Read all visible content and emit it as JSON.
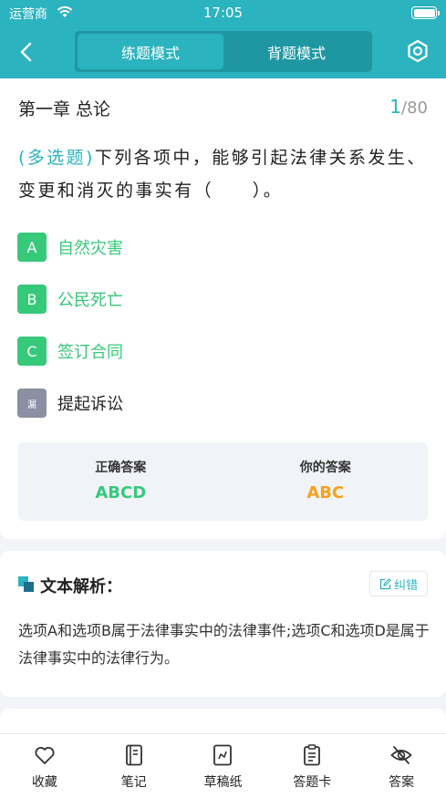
{
  "status_bar": {
    "carrier": "运营商",
    "time": "17:05"
  },
  "header": {
    "modes": [
      {
        "label": "练题模式",
        "active": true
      },
      {
        "label": "背题模式",
        "active": false
      }
    ]
  },
  "question": {
    "chapter": "第一章 总论",
    "progress_current": "1",
    "progress_total": "/80",
    "type_label": "(多选题)",
    "text": "下列各项中，能够引起法律关系发生、变更和消灭的事实有（　　）。",
    "options": [
      {
        "letter": "A",
        "text": "自然灾害",
        "state": "correct"
      },
      {
        "letter": "B",
        "text": "公民死亡",
        "state": "correct"
      },
      {
        "letter": "C",
        "text": "签订合同",
        "state": "correct"
      },
      {
        "letter": "漏",
        "text": "提起诉讼",
        "state": "missed"
      }
    ]
  },
  "answers": {
    "correct_label": "正确答案",
    "correct_value": "ABCD",
    "yours_label": "你的答案",
    "yours_value": "ABC"
  },
  "analysis": {
    "title": "文本解析：",
    "report_label": "纠错",
    "text": "选项A和选项B属于法律事实中的法律事件;选项C和选项D是属于法律事实中的法律行为。"
  },
  "bottom_nav": [
    {
      "label": "收藏",
      "icon": "heart-icon"
    },
    {
      "label": "笔记",
      "icon": "notebook-icon"
    },
    {
      "label": "草稿纸",
      "icon": "draft-icon"
    },
    {
      "label": "答题卡",
      "icon": "answer-card-icon"
    },
    {
      "label": "答案",
      "icon": "eye-off-icon"
    }
  ],
  "colors": {
    "accent": "#2bb3c0",
    "correct": "#37c97a",
    "yours": "#f7a11a",
    "missed": "#8a8fa3"
  }
}
